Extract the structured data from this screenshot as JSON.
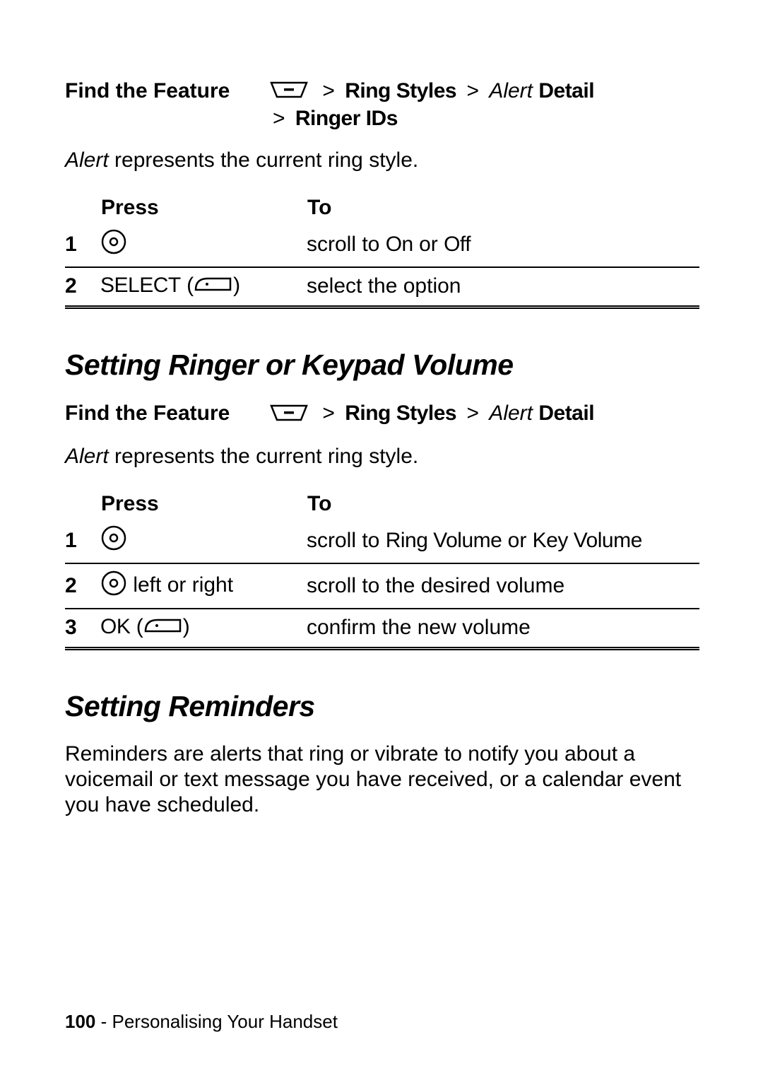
{
  "section1": {
    "find_label": "Find the Feature",
    "path": {
      "sep": ">",
      "menu1": "Ring Styles",
      "alert": "Alert",
      "detail": "Detail",
      "ringer_ids": "Ringer IDs"
    },
    "desc_alert": "Alert",
    "desc_rest": " represents the current ring style.",
    "table": {
      "h_press": "Press",
      "h_to": "To",
      "rows": [
        {
          "n": "1",
          "to_pre": "scroll to ",
          "to_b1": "On",
          "to_mid": " or ",
          "to_b2": "Off"
        },
        {
          "n": "2",
          "press_label": "SELECT",
          "to": "select the option"
        }
      ]
    }
  },
  "section2": {
    "heading": "Setting Ringer or Keypad Volume",
    "find_label": "Find the Feature",
    "path": {
      "sep": ">",
      "menu1": "Ring Styles",
      "alert": "Alert",
      "detail": "Detail"
    },
    "desc_alert": "Alert",
    "desc_rest": " represents the current ring style.",
    "table": {
      "h_press": "Press",
      "h_to": "To",
      "rows": [
        {
          "n": "1",
          "to_pre": "scroll to ",
          "to_b1": "Ring Volume",
          "to_mid": " or ",
          "to_b2": "Key Volume"
        },
        {
          "n": "2",
          "press_suffix": " left or right",
          "to": "scroll to the desired volume"
        },
        {
          "n": "3",
          "press_label": "OK",
          "to": "confirm the new volume"
        }
      ]
    }
  },
  "section3": {
    "heading": "Setting Reminders",
    "body": "Reminders are alerts that ring or vibrate to notify you about a voicemail or text message you have received, or a calendar event you have scheduled."
  },
  "footer": {
    "page_number": "100",
    "sep": " - ",
    "title": "Personalising Your Handset"
  }
}
